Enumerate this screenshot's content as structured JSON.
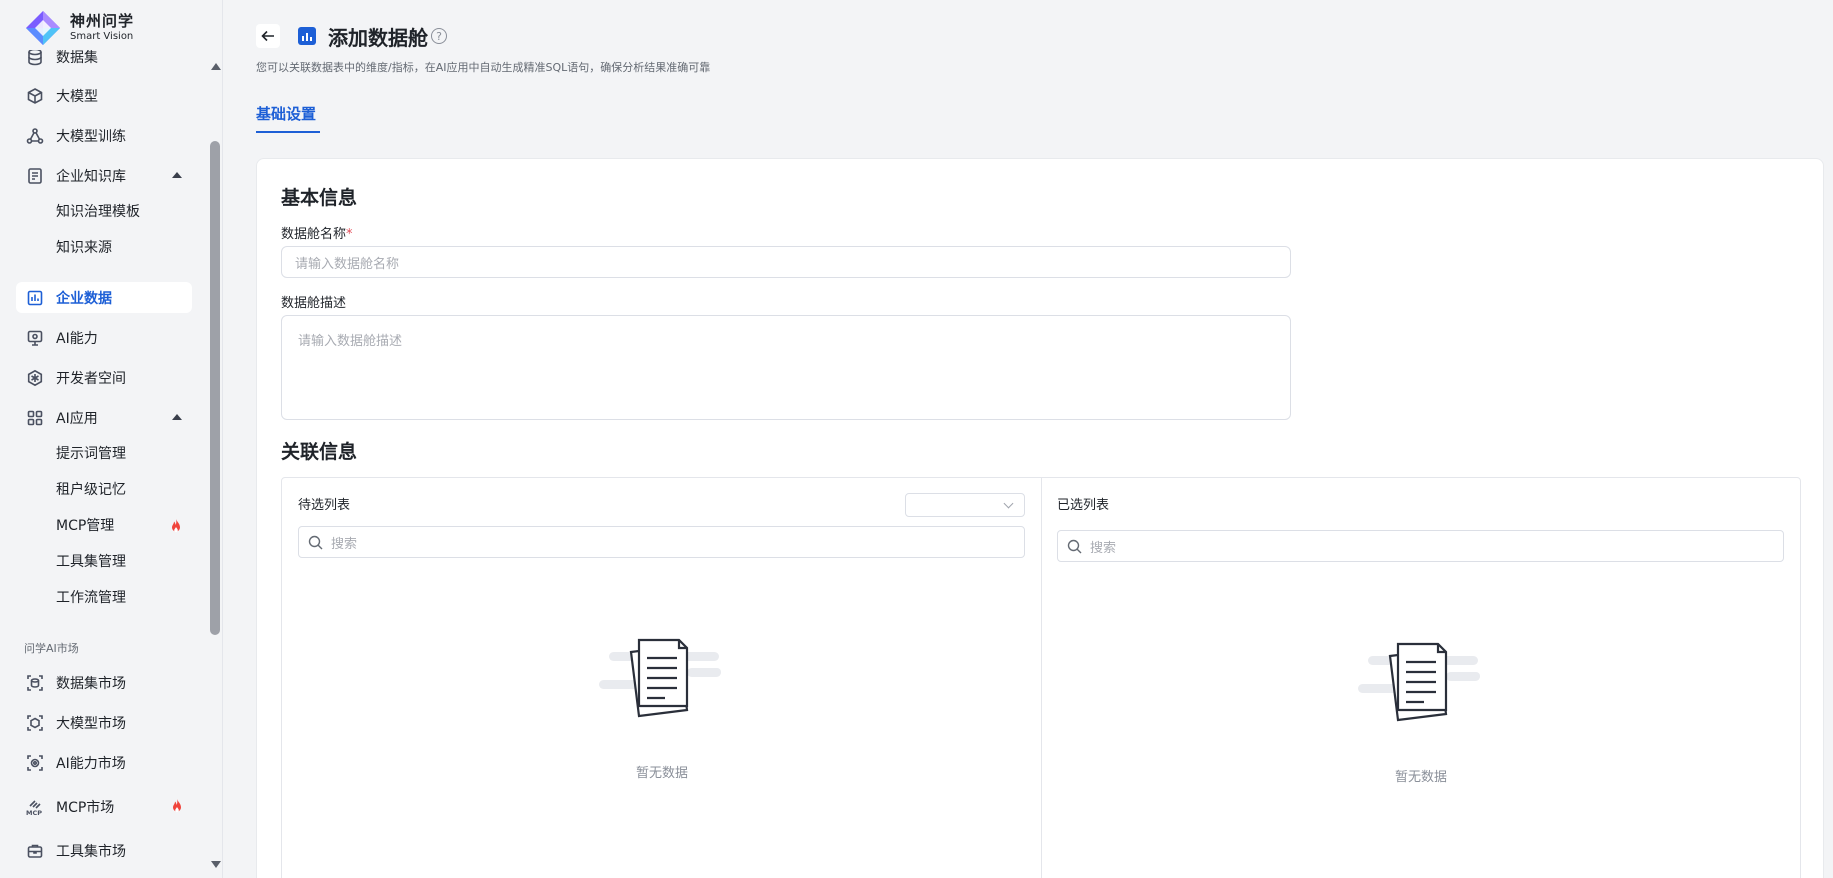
{
  "brand": {
    "name_cn": "神州问学",
    "name_en": "Smart Vision"
  },
  "sidebar": {
    "items": [
      {
        "label": "数据集",
        "icon": "database-icon"
      },
      {
        "label": "大模型",
        "icon": "cube-icon"
      },
      {
        "label": "大模型训练",
        "icon": "triangle-nodes-icon"
      },
      {
        "label": "企业知识库",
        "icon": "notebook-icon",
        "expanded": true
      },
      {
        "label": "企业数据",
        "icon": "bar-chart-icon",
        "active": true
      },
      {
        "label": "AI能力",
        "icon": "monitor-icon"
      },
      {
        "label": "开发者空间",
        "icon": "hexagon-icon"
      },
      {
        "label": "AI应用",
        "icon": "grid-icon",
        "expanded": true
      },
      {
        "label": "数据集市场",
        "icon": "market-dataset-icon"
      },
      {
        "label": "大模型市场",
        "icon": "market-model-icon"
      },
      {
        "label": "AI能力市场",
        "icon": "market-ai-icon"
      },
      {
        "label": "MCP市场",
        "icon": "mcp-icon",
        "hot": true
      },
      {
        "label": "工具集市场",
        "icon": "toolbox-icon"
      }
    ],
    "kb_sub": [
      "知识治理模板",
      "知识来源"
    ],
    "app_sub": [
      "提示词管理",
      "租户级记忆",
      "MCP管理",
      "工具集管理",
      "工作流管理"
    ],
    "section_market": "问学AI市场"
  },
  "header": {
    "title": "添加数据舱",
    "help": "?",
    "description": "您可以关联数据表中的维度/指标，在AI应用中自动生成精准SQL语句，确保分析结果准确可靠",
    "tab": "基础设置"
  },
  "form": {
    "basic_title": "基本信息",
    "name_label": "数据舱名称",
    "required_mark": "*",
    "name_placeholder": "请输入数据舱名称",
    "desc_label": "数据舱描述",
    "desc_placeholder": "请输入数据舱描述",
    "relation_title": "关联信息"
  },
  "transfer": {
    "left_title": "待选列表",
    "right_title": "已选列表",
    "search_placeholder": "搜索",
    "empty_text": "暂无数据"
  },
  "colors": {
    "accent": "#1d5fd6",
    "hot": "#f0443c"
  }
}
